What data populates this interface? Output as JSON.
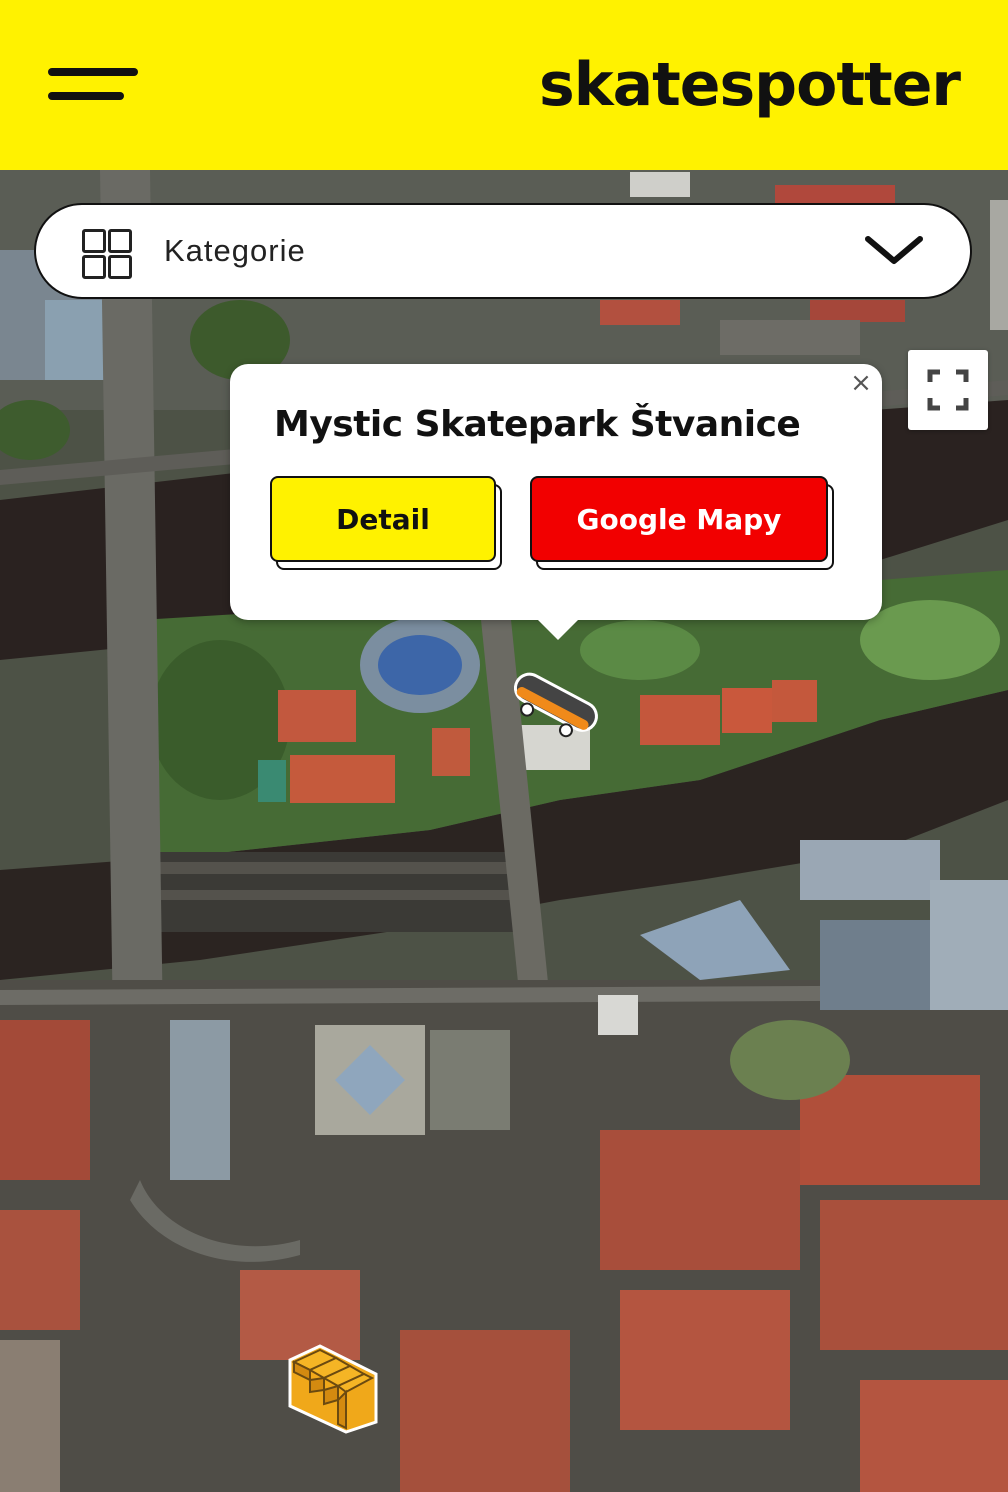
{
  "header": {
    "brand": "skatespotter",
    "menu_icon": "hamburger-menu-icon"
  },
  "filter": {
    "label": "Kategorie",
    "icon": "grid-icon",
    "toggle_icon": "chevron-down-icon"
  },
  "map": {
    "fullscreen_icon": "fullscreen-icon",
    "markers": [
      {
        "type": "skateboard-icon",
        "selected": true
      },
      {
        "type": "stairs-icon",
        "selected": false
      }
    ]
  },
  "popup": {
    "title": "Mystic Skatepark Štvanice",
    "detail_label": "Detail",
    "google_label": "Google Mapy",
    "close_label": "×"
  },
  "colors": {
    "brand_yellow": "#FFF200",
    "google_red": "#F20000",
    "river": "#2a2220"
  }
}
